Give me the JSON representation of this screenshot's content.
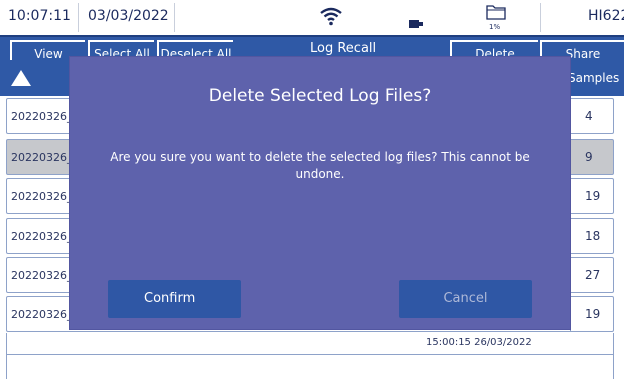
{
  "status": {
    "time": "10:07:11",
    "date": "03/03/2022",
    "storage_percent": "1%",
    "device": "HI622"
  },
  "toolbar": {
    "view_label": "View",
    "select_all_label": "Select All",
    "deselect_all_label": "Deselect All",
    "title": "Log Recall",
    "delete_label": "Delete",
    "share_label": "Share"
  },
  "table": {
    "samples_header": "Samples",
    "rows": [
      {
        "name": "20220326_(",
        "samples": "4",
        "selected": false
      },
      {
        "name": "20220326_(",
        "samples": "9",
        "selected": true
      },
      {
        "name": "20220326_",
        "samples": "19",
        "selected": false
      },
      {
        "name": "20220326_",
        "samples": "18",
        "selected": false
      },
      {
        "name": "20220326_",
        "samples": "27",
        "selected": false
      },
      {
        "name": "20220326_",
        "samples": "19",
        "selected": false
      }
    ],
    "footer_timestamp": "15:00:15 26/03/2022"
  },
  "dialog": {
    "title": "Delete Selected Log Files?",
    "message": "Are you sure you want to delete the selected log files? This cannot be undone.",
    "confirm_label": "Confirm",
    "cancel_label": "Cancel"
  },
  "colors": {
    "primary": "#2f59a6",
    "dialog_bg": "#5e62ac",
    "selected_row": "#c6c8cc"
  }
}
